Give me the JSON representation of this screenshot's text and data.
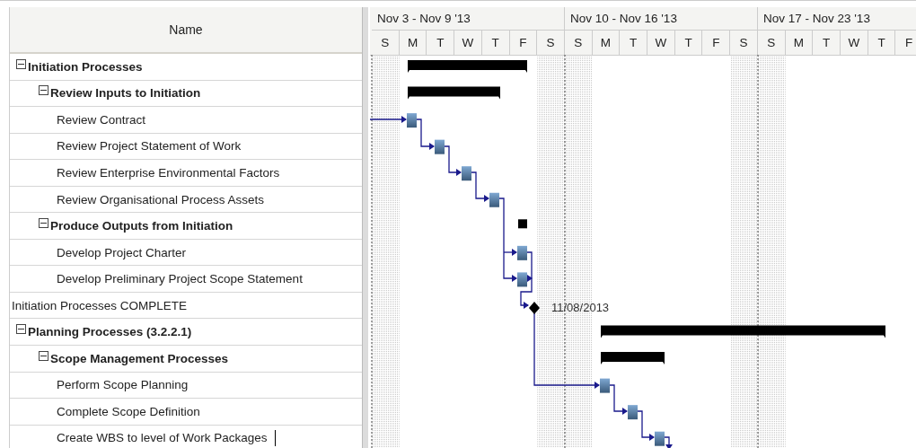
{
  "table": {
    "columns": [
      "Name"
    ]
  },
  "timeline": {
    "weeks": [
      {
        "label": "Nov 3 - Nov 9 '13",
        "days": [
          "S",
          "M",
          "T",
          "W",
          "T",
          "F",
          "S"
        ]
      },
      {
        "label": "Nov 10 - Nov 16 '13",
        "days": [
          "S",
          "M",
          "T",
          "W",
          "T",
          "F",
          "S"
        ]
      },
      {
        "label": "Nov 17 - Nov 23 '13",
        "days": [
          "S",
          "M",
          "T",
          "W",
          "T",
          "F"
        ]
      }
    ]
  },
  "rows": [
    {
      "name": "Initiation Processes",
      "kind": "summary",
      "expanded": true,
      "children": [
        {
          "name": "Review Inputs to Initiation",
          "kind": "summary",
          "expanded": true,
          "children": [
            {
              "name": "Review Contract",
              "kind": "task"
            },
            {
              "name": "Review Project Statement of Work",
              "kind": "task"
            },
            {
              "name": "Review Enterprise Environmental Factors",
              "kind": "task"
            },
            {
              "name": "Review Organisational Process Assets",
              "kind": "task"
            }
          ]
        },
        {
          "name": "Produce Outputs from Initiation",
          "kind": "summary",
          "expanded": true,
          "children": [
            {
              "name": "Develop Project Charter",
              "kind": "task"
            },
            {
              "name": "Develop Preliminary Project Scope Statement",
              "kind": "task"
            }
          ]
        }
      ]
    },
    {
      "name": "Initiation Processes COMPLETE",
      "kind": "milestone",
      "date_label": "11/08/2013"
    },
    {
      "name": "Planning Processes (3.2.2.1)",
      "kind": "summary",
      "expanded": true,
      "children": [
        {
          "name": "Scope Management Processes",
          "kind": "summary",
          "expanded": true,
          "children": [
            {
              "name": "Perform Scope Planning",
              "kind": "task"
            },
            {
              "name": "Complete Scope Definition",
              "kind": "task"
            },
            {
              "name": "Create WBS to level of Work Packages",
              "kind": "task",
              "editing": true
            }
          ]
        }
      ]
    }
  ]
}
